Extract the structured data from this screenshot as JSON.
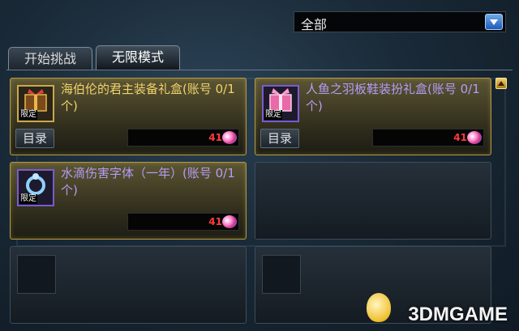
{
  "category": {
    "selected": "全部"
  },
  "tabs": [
    {
      "label": "开始挑战",
      "active": false
    },
    {
      "label": "无限模式",
      "active": true
    }
  ],
  "items": [
    {
      "title": "海伯伦的君主装备礼盒(账号 0/1个)",
      "badge": "限定",
      "catalog_label": "目录",
      "price": "41",
      "title_color": "#f1d36a",
      "icon": "gift-box-icon"
    },
    {
      "title": "人鱼之羽板鞋装扮礼盒(账号 0/1个)",
      "badge": "限定",
      "catalog_label": "目录",
      "price": "41",
      "title_color": "#b49cf6",
      "icon": "pink-gift-icon"
    },
    {
      "title": "水滴伤害字体（一年）(账号 0/1个)",
      "badge": "限定",
      "price": "41",
      "title_color": "#b49cf6",
      "icon": "ring-icon"
    }
  ],
  "watermark": "3DMGAME",
  "colors": {
    "selected_border": "#b89a3a",
    "price": "#ff3b3b",
    "accent_blue": "#1e5bb8"
  }
}
